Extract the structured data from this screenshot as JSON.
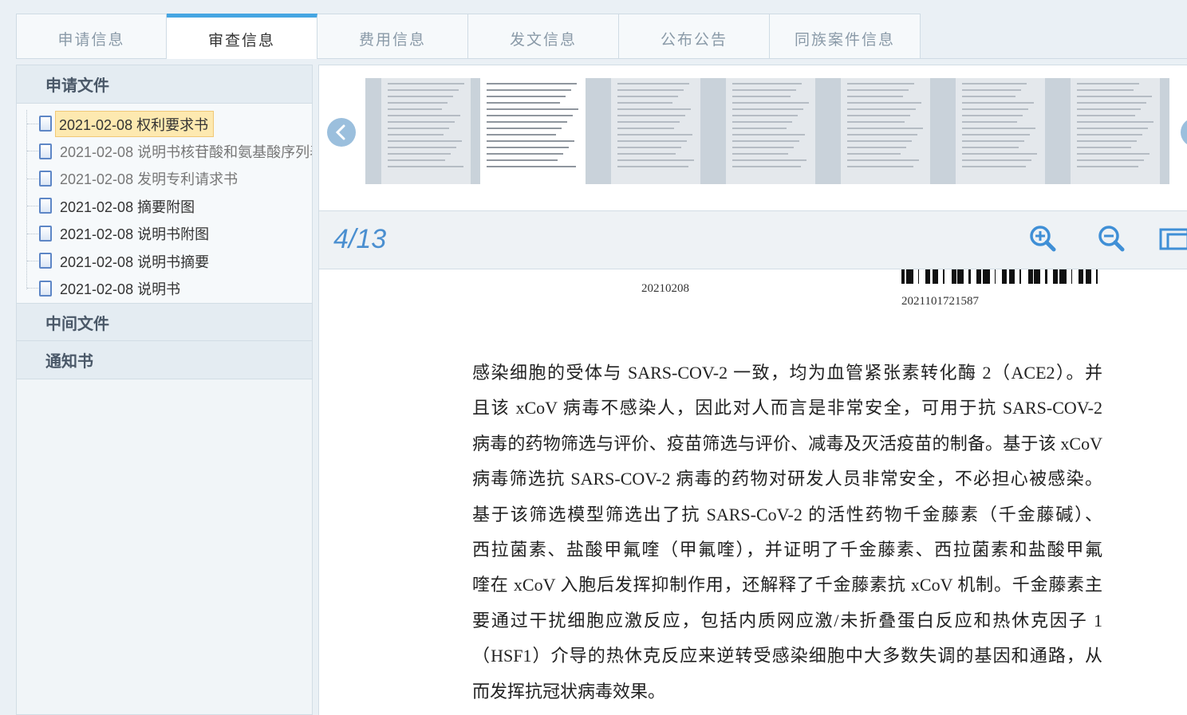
{
  "tabs": [
    {
      "label": "申请信息",
      "active": false
    },
    {
      "label": "审查信息",
      "active": true
    },
    {
      "label": "费用信息",
      "active": false
    },
    {
      "label": "发文信息",
      "active": false
    },
    {
      "label": "公布公告",
      "active": false
    },
    {
      "label": "同族案件信息",
      "active": false
    }
  ],
  "sidebar": {
    "section_application": "申请文件",
    "files": [
      {
        "label": "2021-02-08 权利要求书",
        "selected": true
      },
      {
        "label": "2021-02-08 说明书核苷酸和氨基酸序列表",
        "selected": false
      },
      {
        "label": "2021-02-08 发明专利请求书",
        "selected": false
      },
      {
        "label": "2021-02-08 摘要附图",
        "selected": false
      },
      {
        "label": "2021-02-08 说明书附图",
        "selected": false
      },
      {
        "label": "2021-02-08 说明书摘要",
        "selected": false
      },
      {
        "label": "2021-02-08 说明书",
        "selected": false
      }
    ],
    "section_intermediate": "中间文件",
    "section_notices": "通知书"
  },
  "viewer": {
    "page_counter": "4/13",
    "thumbnail_count": 7,
    "active_thumbnail": 2,
    "icons": {
      "prev": "chevron-left-icon",
      "next": "chevron-right-icon",
      "zoom_in": "zoom-in-icon",
      "zoom_out": "zoom-out-icon",
      "fit": "fit-page-icon"
    },
    "accent_color": "#45a5e2"
  },
  "document": {
    "filing_date": "20210208",
    "barcode_number": "2021101721587",
    "lines": [
      "感染细胞的受体与 SARS-COV-2 一致，均为血管紧张素转化酶 2（ACE2）。并",
      "且该 xCoV 病毒不感染人，因此对人而言是非常安全，可用于抗 SARS-COV-2",
      "病毒的药物筛选与评价、疫苗筛选与评价、减毒及灭活疫苗的制备。基于该 xCoV",
      "病毒筛选抗 SARS-COV-2 病毒的药物对研发人员非常安全，不必担心被感染。",
      "基于该筛选模型筛选出了抗 SARS-CoV-2 的活性药物千金藤素（千金藤碱）、",
      "西拉菌素、盐酸甲氟喹（甲氟喹），并证明了千金藤素、西拉菌素和盐酸甲氟",
      "喹在 xCoV 入胞后发挥抑制作用，还解释了千金藤素抗 xCoV 机制。千金藤素主",
      "要通过干扰细胞应激反应，包括内质网应激/未折叠蛋白反应和热休克因子 1",
      "（HSF1）介导的热休克反应来逆转受感染细胞中大多数失调的基因和通路，从",
      "而发挥抗冠状病毒效果。"
    ]
  }
}
